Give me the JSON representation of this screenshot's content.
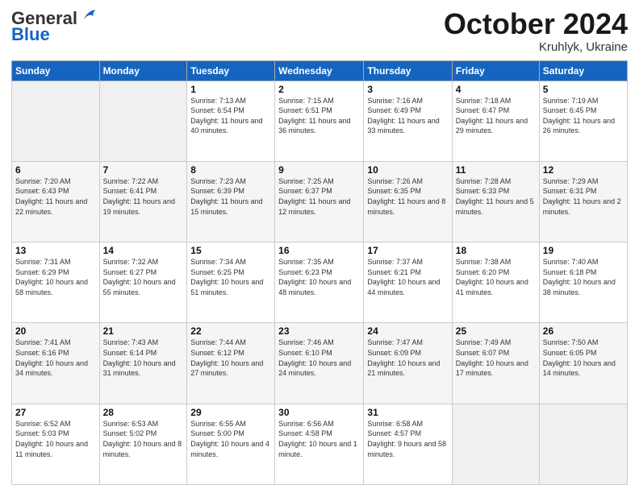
{
  "header": {
    "logo_general": "General",
    "logo_blue": "Blue",
    "month_title": "October 2024",
    "location": "Kruhlyk, Ukraine"
  },
  "weekdays": [
    "Sunday",
    "Monday",
    "Tuesday",
    "Wednesday",
    "Thursday",
    "Friday",
    "Saturday"
  ],
  "rows": [
    [
      {
        "day": "",
        "sunrise": "",
        "sunset": "",
        "daylight": ""
      },
      {
        "day": "",
        "sunrise": "",
        "sunset": "",
        "daylight": ""
      },
      {
        "day": "1",
        "sunrise": "Sunrise: 7:13 AM",
        "sunset": "Sunset: 6:54 PM",
        "daylight": "Daylight: 11 hours and 40 minutes."
      },
      {
        "day": "2",
        "sunrise": "Sunrise: 7:15 AM",
        "sunset": "Sunset: 6:51 PM",
        "daylight": "Daylight: 11 hours and 36 minutes."
      },
      {
        "day": "3",
        "sunrise": "Sunrise: 7:16 AM",
        "sunset": "Sunset: 6:49 PM",
        "daylight": "Daylight: 11 hours and 33 minutes."
      },
      {
        "day": "4",
        "sunrise": "Sunrise: 7:18 AM",
        "sunset": "Sunset: 6:47 PM",
        "daylight": "Daylight: 11 hours and 29 minutes."
      },
      {
        "day": "5",
        "sunrise": "Sunrise: 7:19 AM",
        "sunset": "Sunset: 6:45 PM",
        "daylight": "Daylight: 11 hours and 26 minutes."
      }
    ],
    [
      {
        "day": "6",
        "sunrise": "Sunrise: 7:20 AM",
        "sunset": "Sunset: 6:43 PM",
        "daylight": "Daylight: 11 hours and 22 minutes."
      },
      {
        "day": "7",
        "sunrise": "Sunrise: 7:22 AM",
        "sunset": "Sunset: 6:41 PM",
        "daylight": "Daylight: 11 hours and 19 minutes."
      },
      {
        "day": "8",
        "sunrise": "Sunrise: 7:23 AM",
        "sunset": "Sunset: 6:39 PM",
        "daylight": "Daylight: 11 hours and 15 minutes."
      },
      {
        "day": "9",
        "sunrise": "Sunrise: 7:25 AM",
        "sunset": "Sunset: 6:37 PM",
        "daylight": "Daylight: 11 hours and 12 minutes."
      },
      {
        "day": "10",
        "sunrise": "Sunrise: 7:26 AM",
        "sunset": "Sunset: 6:35 PM",
        "daylight": "Daylight: 11 hours and 8 minutes."
      },
      {
        "day": "11",
        "sunrise": "Sunrise: 7:28 AM",
        "sunset": "Sunset: 6:33 PM",
        "daylight": "Daylight: 11 hours and 5 minutes."
      },
      {
        "day": "12",
        "sunrise": "Sunrise: 7:29 AM",
        "sunset": "Sunset: 6:31 PM",
        "daylight": "Daylight: 11 hours and 2 minutes."
      }
    ],
    [
      {
        "day": "13",
        "sunrise": "Sunrise: 7:31 AM",
        "sunset": "Sunset: 6:29 PM",
        "daylight": "Daylight: 10 hours and 58 minutes."
      },
      {
        "day": "14",
        "sunrise": "Sunrise: 7:32 AM",
        "sunset": "Sunset: 6:27 PM",
        "daylight": "Daylight: 10 hours and 55 minutes."
      },
      {
        "day": "15",
        "sunrise": "Sunrise: 7:34 AM",
        "sunset": "Sunset: 6:25 PM",
        "daylight": "Daylight: 10 hours and 51 minutes."
      },
      {
        "day": "16",
        "sunrise": "Sunrise: 7:35 AM",
        "sunset": "Sunset: 6:23 PM",
        "daylight": "Daylight: 10 hours and 48 minutes."
      },
      {
        "day": "17",
        "sunrise": "Sunrise: 7:37 AM",
        "sunset": "Sunset: 6:21 PM",
        "daylight": "Daylight: 10 hours and 44 minutes."
      },
      {
        "day": "18",
        "sunrise": "Sunrise: 7:38 AM",
        "sunset": "Sunset: 6:20 PM",
        "daylight": "Daylight: 10 hours and 41 minutes."
      },
      {
        "day": "19",
        "sunrise": "Sunrise: 7:40 AM",
        "sunset": "Sunset: 6:18 PM",
        "daylight": "Daylight: 10 hours and 38 minutes."
      }
    ],
    [
      {
        "day": "20",
        "sunrise": "Sunrise: 7:41 AM",
        "sunset": "Sunset: 6:16 PM",
        "daylight": "Daylight: 10 hours and 34 minutes."
      },
      {
        "day": "21",
        "sunrise": "Sunrise: 7:43 AM",
        "sunset": "Sunset: 6:14 PM",
        "daylight": "Daylight: 10 hours and 31 minutes."
      },
      {
        "day": "22",
        "sunrise": "Sunrise: 7:44 AM",
        "sunset": "Sunset: 6:12 PM",
        "daylight": "Daylight: 10 hours and 27 minutes."
      },
      {
        "day": "23",
        "sunrise": "Sunrise: 7:46 AM",
        "sunset": "Sunset: 6:10 PM",
        "daylight": "Daylight: 10 hours and 24 minutes."
      },
      {
        "day": "24",
        "sunrise": "Sunrise: 7:47 AM",
        "sunset": "Sunset: 6:09 PM",
        "daylight": "Daylight: 10 hours and 21 minutes."
      },
      {
        "day": "25",
        "sunrise": "Sunrise: 7:49 AM",
        "sunset": "Sunset: 6:07 PM",
        "daylight": "Daylight: 10 hours and 17 minutes."
      },
      {
        "day": "26",
        "sunrise": "Sunrise: 7:50 AM",
        "sunset": "Sunset: 6:05 PM",
        "daylight": "Daylight: 10 hours and 14 minutes."
      }
    ],
    [
      {
        "day": "27",
        "sunrise": "Sunrise: 6:52 AM",
        "sunset": "Sunset: 5:03 PM",
        "daylight": "Daylight: 10 hours and 11 minutes."
      },
      {
        "day": "28",
        "sunrise": "Sunrise: 6:53 AM",
        "sunset": "Sunset: 5:02 PM",
        "daylight": "Daylight: 10 hours and 8 minutes."
      },
      {
        "day": "29",
        "sunrise": "Sunrise: 6:55 AM",
        "sunset": "Sunset: 5:00 PM",
        "daylight": "Daylight: 10 hours and 4 minutes."
      },
      {
        "day": "30",
        "sunrise": "Sunrise: 6:56 AM",
        "sunset": "Sunset: 4:58 PM",
        "daylight": "Daylight: 10 hours and 1 minute."
      },
      {
        "day": "31",
        "sunrise": "Sunrise: 6:58 AM",
        "sunset": "Sunset: 4:57 PM",
        "daylight": "Daylight: 9 hours and 58 minutes."
      },
      {
        "day": "",
        "sunrise": "",
        "sunset": "",
        "daylight": ""
      },
      {
        "day": "",
        "sunrise": "",
        "sunset": "",
        "daylight": ""
      }
    ]
  ]
}
